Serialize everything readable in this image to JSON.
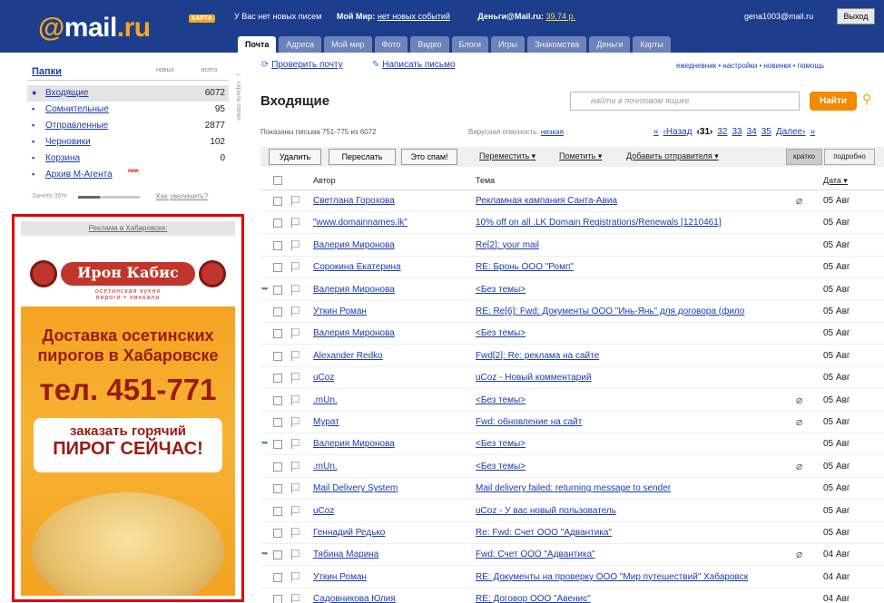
{
  "header": {
    "logo_prefix": "@",
    "logo_main": "mail",
    "logo_suffix": ".ru",
    "logo_badge": "КАРТА",
    "no_new_mail": "У Вас нет новых писем",
    "my_world_label": "Мой Мир:",
    "my_world_link": "нет новых событий",
    "money_label": "Деньги@Mail.ru:",
    "money_amount": "39,74 р.",
    "user_email": "gena1003@mail.ru",
    "exit_label": "Выход"
  },
  "tabs": [
    "Почта",
    "Адреса",
    "Мой мир",
    "Фото",
    "Видео",
    "Блоги",
    "Игры",
    "Знакомства",
    "Деньги",
    "Карты"
  ],
  "sidebar": {
    "title": "Папки",
    "col_new": "новых",
    "col_all": "всего",
    "hide_label": "скрыть папки",
    "folders": [
      {
        "name": "Входящие",
        "count": "6072"
      },
      {
        "name": "Сомнительные",
        "count": "95"
      },
      {
        "name": "Отправленные",
        "count": "2877"
      },
      {
        "name": "Черновики",
        "count": "102"
      },
      {
        "name": "Корзина",
        "count": "0"
      },
      {
        "name": "Архив М-Агента",
        "count": ""
      }
    ],
    "new_badge": "new",
    "storage_text": "Занято 35%",
    "storage_fraction": 0.35,
    "storage_link": "Как увеличить?"
  },
  "ad": {
    "caption": "Реклама в Хабаровске:",
    "brand": "Ирон Кабис",
    "sub1": "осетинская кухня",
    "sub2": "пироги • хинкали",
    "line1": "Доставка осетинских",
    "line2": "пирогов в Хабаровске",
    "phone": "тел. 451-771",
    "cta1": "заказать горячий",
    "cta2": "ПИРОГ СЕЙЧАС!"
  },
  "toolbar": {
    "check_mail": "Проверить почту",
    "write_letter": "Написать письмо",
    "right_links": "ежедневник • настройки • новинки • помощь"
  },
  "inbox": {
    "title": "Входящие",
    "search_placeholder": "найти в почтовом ящике",
    "search_button": "Найти",
    "shown": "Показаны письма 751-775 из 6072",
    "virus_label": "Вирусная опасность:",
    "virus_level": "низкая",
    "pager": {
      "first": "«",
      "prev": "‹Назад",
      "current": "‹31›",
      "pages": [
        "32",
        "33",
        "34",
        "35"
      ],
      "next": "Далее›",
      "last": "»"
    }
  },
  "actions": {
    "delete": "Удалить",
    "forward": "Переслать",
    "spam": "Это спам!",
    "move": "Переместить ▾",
    "mark": "Пометить ▾",
    "add_sender": "Добавить отправителя ▾",
    "view_short": "кратко",
    "view_full": "подробно"
  },
  "columns": {
    "author": "Автор",
    "subject": "Тема",
    "date": "Дата ▾"
  },
  "messages": [
    {
      "author": "Светлана Горохова",
      "subject": "Рекламная кампания Санта-Авиа",
      "date": "05 Авг",
      "clip": true,
      "reply": false
    },
    {
      "author": "\"www.domainnames.lk\"",
      "subject": "10% off on all .LK Domain Registrations/Renewals [1210461]",
      "date": "05 Авг",
      "clip": false,
      "reply": false
    },
    {
      "author": "Валерия Миронова",
      "subject": "Re[2]: your mail",
      "date": "05 Авг",
      "clip": false,
      "reply": false
    },
    {
      "author": "Сорокина Екатерина",
      "subject": "RE: Бронь ООО \"Ромп\"",
      "date": "05 Авг",
      "clip": false,
      "reply": false
    },
    {
      "author": "Валерия Миронова",
      "subject": "<Без темы>",
      "date": "05 Авг",
      "clip": false,
      "reply": true
    },
    {
      "author": "Уткин Роман",
      "subject": "RE: Re[6]: Fwd: Документы ООО \"Инь-Янь\" для договора (фило",
      "date": "05 Авг",
      "clip": false,
      "reply": false
    },
    {
      "author": "Валерия Миронова",
      "subject": "<Без темы>",
      "date": "05 Авг",
      "clip": false,
      "reply": false
    },
    {
      "author": "Alexander Redko",
      "subject": "Fwd[2]: Re: реклама на сайте",
      "date": "05 Авг",
      "clip": false,
      "reply": false
    },
    {
      "author": "uCoz",
      "subject": "uCoz - Новый комментарий",
      "date": "05 Авг",
      "clip": false,
      "reply": false
    },
    {
      "author": ".mUn.",
      "subject": "<Без темы>",
      "date": "05 Авг",
      "clip": true,
      "reply": false
    },
    {
      "author": "Мурат",
      "subject": "Fwd: обновление на сайт",
      "date": "05 Авг",
      "clip": true,
      "reply": false
    },
    {
      "author": "Валерия Миронова",
      "subject": "<Без темы>",
      "date": "05 Авг",
      "clip": false,
      "reply": true
    },
    {
      "author": ".mUn.",
      "subject": "<Без темы>",
      "date": "05 Авг",
      "clip": true,
      "reply": false
    },
    {
      "author": "Mail Delivery System",
      "subject": "Mail delivery failed: returning message to sender",
      "date": "05 Авг",
      "clip": false,
      "reply": false
    },
    {
      "author": "uCoz",
      "subject": "uCoz - У вас новый пользователь",
      "date": "05 Авг",
      "clip": false,
      "reply": false
    },
    {
      "author": "Геннадий Редько",
      "subject": "Re: Fwd: Счет ООО \"Адвантика\"",
      "date": "05 Авг",
      "clip": false,
      "reply": false
    },
    {
      "author": "Тябина Марина",
      "subject": "Fwd: Счет ООО \"Адвантика\"",
      "date": "04 Авг",
      "clip": true,
      "reply": true
    },
    {
      "author": "Уткин Роман",
      "subject": "RE: Документы на проверку ООО \"Мир путешествий\" Хабаровск",
      "date": "04 Авг",
      "clip": false,
      "reply": false
    },
    {
      "author": "Садовникова Юлия",
      "subject": "RE: Договор ООО \"Авенис\"",
      "date": "04 Авг",
      "clip": false,
      "reply": false
    }
  ]
}
